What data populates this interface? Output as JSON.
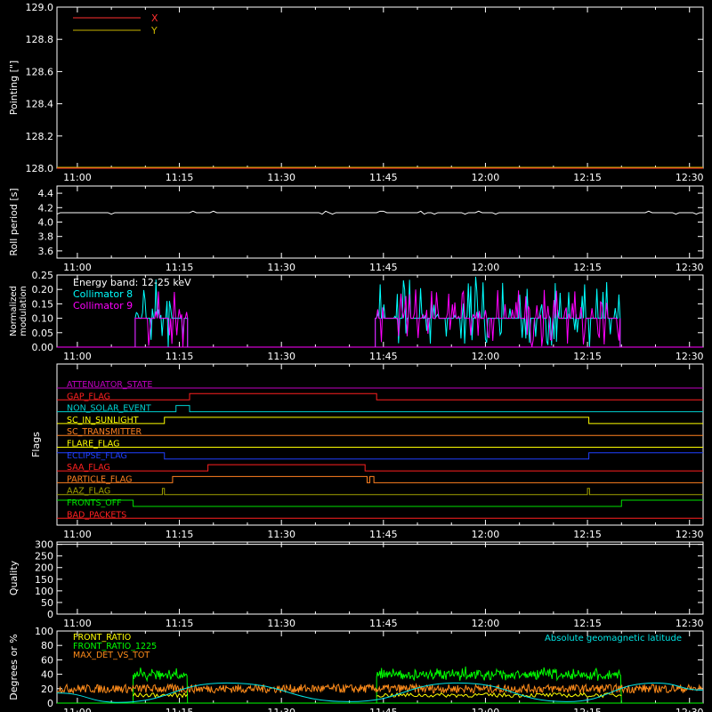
{
  "x_ticks": [
    "11:00",
    "11:15",
    "11:30",
    "11:45",
    "12:00",
    "12:15",
    "12:30"
  ],
  "x_tick_minutes": [
    0,
    15,
    30,
    45,
    60,
    75,
    90
  ],
  "x_range_minutes": [
    -3,
    92
  ],
  "colors": {
    "axis": "#ffffff",
    "x": "#ff3030",
    "y": "#c8b400",
    "collimator8": "#00ffff",
    "collimator9": "#ff00ff",
    "front_ratio": "#ffff00",
    "front_ratio_1225": "#00ff00",
    "max_det_vs_tot": "#ff8c1a",
    "geomag": "#00e5e5"
  },
  "chart_data": [
    {
      "type": "line",
      "ylabel": "Pointing [\"]",
      "ylim": [
        128.0,
        129.0
      ],
      "y_ticks": [
        "128.0",
        "128.2",
        "128.4",
        "128.6",
        "128.8",
        "129.0"
      ],
      "y_tick_values": [
        128.0,
        128.2,
        128.4,
        128.6,
        128.8,
        129.0
      ],
      "legend": [
        "X",
        "Y"
      ],
      "series": [
        {
          "name": "X",
          "x": [
            -3,
            92
          ],
          "values": [
            128.0,
            128.0
          ]
        },
        {
          "name": "Y",
          "x": [
            -3,
            92
          ],
          "values": [
            128.0,
            128.0
          ]
        }
      ]
    },
    {
      "type": "line",
      "ylabel": "Roll period [s]",
      "ylim": [
        3.5,
        4.5
      ],
      "y_ticks": [
        "3.6",
        "3.8",
        "4.0",
        "4.2",
        "4.4"
      ],
      "y_tick_values": [
        3.6,
        3.8,
        4.0,
        4.2,
        4.4
      ],
      "series": [
        {
          "x": [
            -3,
            92
          ],
          "values": [
            4.13,
            4.13
          ]
        }
      ]
    },
    {
      "type": "line",
      "ylabel": "Normalized modulation",
      "ylabel_lines": [
        "Normalized",
        "modulation"
      ],
      "ylim": [
        0.0,
        0.25
      ],
      "y_ticks": [
        "0.00",
        "0.05",
        "0.10",
        "0.15",
        "0.20",
        "0.25"
      ],
      "y_tick_values": [
        0.0,
        0.05,
        0.1,
        0.15,
        0.2,
        0.25
      ],
      "annotation": "Energy band: 12-25 keV",
      "legend": [
        "Collimator 8",
        "Collimator 9"
      ],
      "segments": [
        [
          8.5,
          16.2
        ],
        [
          43.8,
          79.8
        ]
      ],
      "baseline": 0.1,
      "max_value": 0.245
    },
    {
      "type": "line",
      "ylabel": "Flags",
      "flags": [
        {
          "name": "ATTENUATOR_STATE",
          "color": "#c000c0",
          "steps": [
            [
              -3,
              0
            ],
            [
              92,
              0
            ]
          ]
        },
        {
          "name": "GAP_FLAG",
          "color": "#ff2020",
          "steps": [
            [
              -3,
              0
            ],
            [
              16.5,
              1
            ],
            [
              44,
              0
            ],
            [
              92,
              0
            ]
          ]
        },
        {
          "name": "NON_SOLAR_EVENT",
          "color": "#00d0d0",
          "steps": [
            [
              -3,
              0
            ],
            [
              14.5,
              1
            ],
            [
              16.5,
              0
            ],
            [
              92,
              0
            ]
          ]
        },
        {
          "name": "SC_IN_SUNLIGHT",
          "color": "#ffff00",
          "steps": [
            [
              -3,
              0
            ],
            [
              12.8,
              1
            ],
            [
              75.2,
              0
            ],
            [
              92,
              0
            ]
          ]
        },
        {
          "name": "SC_TRANSMITTER",
          "color": "#ff8020",
          "steps": [
            [
              -3,
              0
            ],
            [
              92,
              0
            ]
          ]
        },
        {
          "name": "FLARE_FLAG",
          "color": "#ffff00",
          "steps": [
            [
              -3,
              0
            ],
            [
              92,
              0
            ]
          ]
        },
        {
          "name": "ECLIPSE_FLAG",
          "color": "#2040ff",
          "steps": [
            [
              -3,
              1
            ],
            [
              12.8,
              0
            ],
            [
              75.2,
              1
            ],
            [
              92,
              1
            ]
          ]
        },
        {
          "name": "SAA_FLAG",
          "color": "#ff2020",
          "steps": [
            [
              -3,
              0
            ],
            [
              19.2,
              1
            ],
            [
              42.3,
              0
            ],
            [
              92,
              0
            ]
          ]
        },
        {
          "name": "PARTICLE_FLAG",
          "color": "#ff8020",
          "steps": [
            [
              -3,
              0
            ],
            [
              14.0,
              1
            ],
            [
              42.6,
              0
            ],
            [
              43.0,
              1
            ],
            [
              43.6,
              0
            ],
            [
              92,
              0
            ]
          ]
        },
        {
          "name": "AAZ_FLAG",
          "color": "#a0a000",
          "steps": [
            [
              -3,
              0
            ],
            [
              12.5,
              1
            ],
            [
              12.8,
              0
            ],
            [
              75.0,
              1
            ],
            [
              75.3,
              0
            ],
            [
              92,
              0
            ]
          ]
        },
        {
          "name": "FRONTS_OFF",
          "color": "#00e000",
          "steps": [
            [
              -3,
              1
            ],
            [
              8.2,
              0
            ],
            [
              80.0,
              1
            ],
            [
              92,
              1
            ]
          ]
        },
        {
          "name": "BAD_PACKETS",
          "color": "#ff2020",
          "steps": [
            [
              -3,
              0
            ],
            [
              92,
              0
            ]
          ]
        }
      ]
    },
    {
      "type": "line",
      "ylabel": "Quality",
      "ylim": [
        0,
        310
      ],
      "y_ticks": [
        "0",
        "50",
        "100",
        "150",
        "200",
        "250",
        "300"
      ],
      "y_tick_values": [
        0,
        50,
        100,
        150,
        200,
        250,
        300
      ],
      "series": [
        {
          "x": [
            -3,
            92
          ],
          "values": [
            300,
            300
          ]
        }
      ]
    },
    {
      "type": "line",
      "ylabel": "Degrees or %",
      "ylim": [
        0,
        100
      ],
      "y_ticks": [
        "0",
        "20",
        "40",
        "60",
        "80",
        "100"
      ],
      "y_tick_values": [
        0,
        20,
        40,
        60,
        80,
        100
      ],
      "legend": [
        "FRONT_RATIO",
        "FRONT_RATIO_1225",
        "MAX_DET_VS_TOT"
      ],
      "right_label": "Absolute geomagnetic latitude",
      "front_ratio_segments": [
        [
          8.2,
          16.2
        ],
        [
          44.0,
          80.0
        ]
      ],
      "front_ratio_1225_level": [
        40,
        48
      ],
      "max_det_level": 20,
      "geomag_points": [
        [
          -3,
          14
        ],
        [
          6,
          1
        ],
        [
          22,
          28
        ],
        [
          40,
          2
        ],
        [
          56,
          28
        ],
        [
          72,
          2
        ],
        [
          85,
          28
        ],
        [
          92,
          18
        ]
      ]
    }
  ]
}
